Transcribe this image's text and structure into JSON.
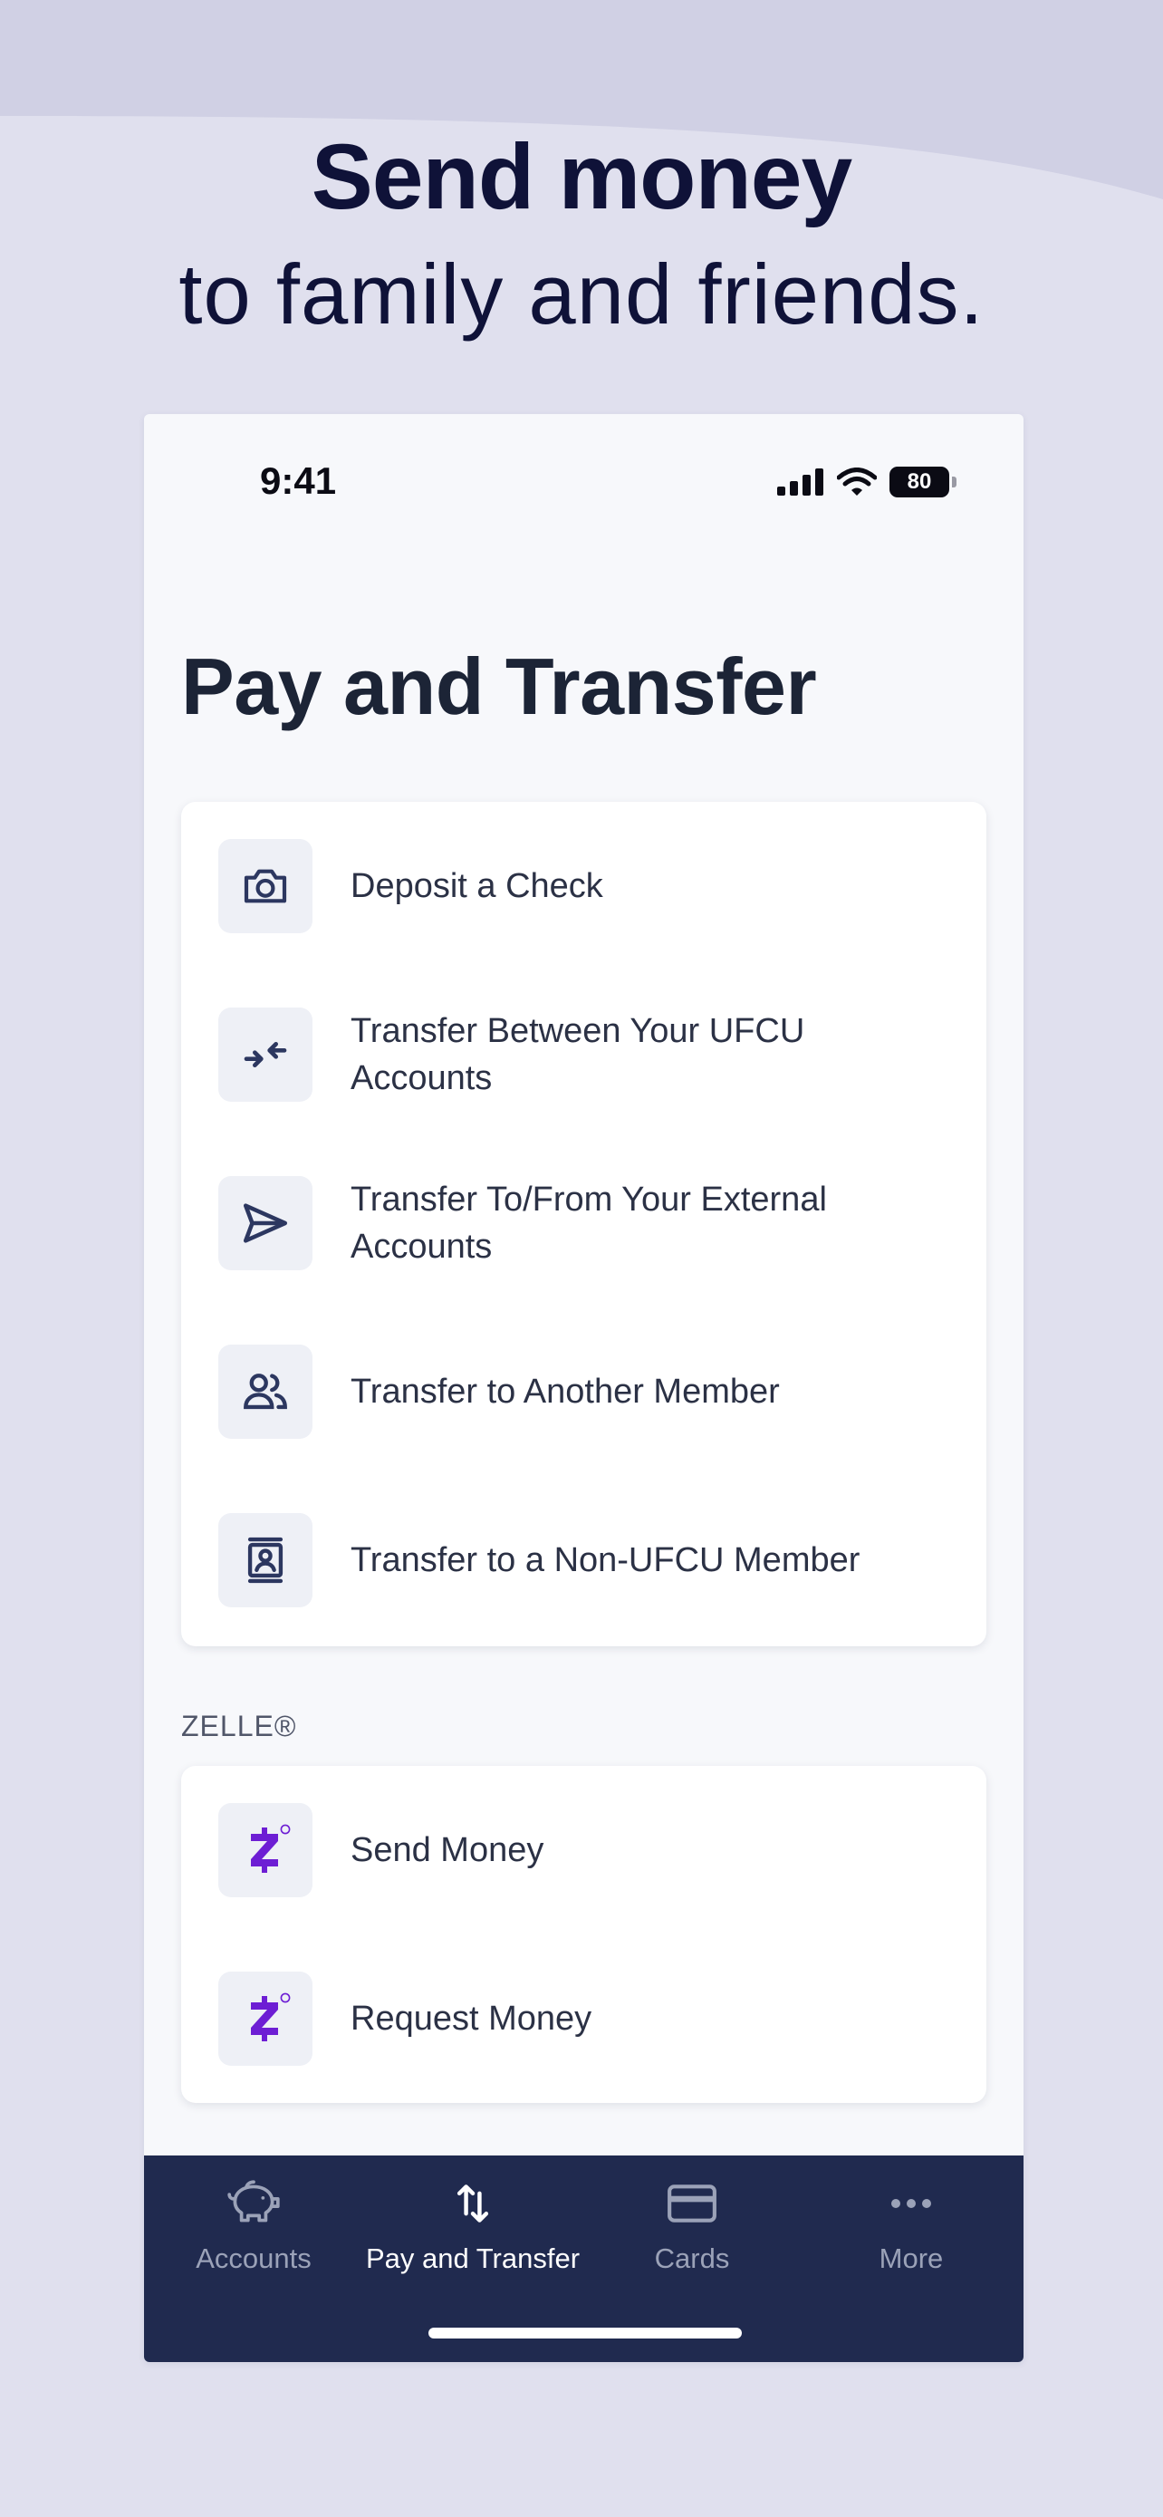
{
  "promo": {
    "title": "Send money",
    "subtitle": "to family and friends."
  },
  "status_bar": {
    "time": "9:41",
    "battery": "80",
    "icons": [
      "cellular-signal-icon",
      "wifi-icon",
      "battery-icon"
    ]
  },
  "page": {
    "title": "Pay and Transfer"
  },
  "actions": [
    {
      "label": "Deposit a Check",
      "icon": "camera-icon"
    },
    {
      "label": "Transfer Between Your UFCU Accounts",
      "icon": "arrows-transfer-icon"
    },
    {
      "label": "Transfer To/From Your External Accounts",
      "icon": "paper-plane-icon"
    },
    {
      "label": "Transfer to Another Member",
      "icon": "people-icon"
    },
    {
      "label": "Transfer to a Non-UFCU Member",
      "icon": "contact-card-icon"
    }
  ],
  "zelle": {
    "header": "ZELLE®",
    "items": [
      {
        "label": "Send Money",
        "icon": "zelle-logo-icon"
      },
      {
        "label": "Request Money",
        "icon": "zelle-logo-icon"
      }
    ]
  },
  "tabs": [
    {
      "label": "Accounts",
      "icon": "piggy-bank-icon",
      "active": false
    },
    {
      "label": "Pay and Transfer",
      "icon": "transfer-arrows-icon",
      "active": true
    },
    {
      "label": "Cards",
      "icon": "credit-card-icon",
      "active": false
    },
    {
      "label": "More",
      "icon": "more-dots-icon",
      "active": false
    }
  ],
  "colors": {
    "background": "#e0e0ee",
    "promo_text": "#0f1238",
    "tab_bar": "#202a4f",
    "icon_tint": "#2c3760",
    "zelle_purple": "#6d1ed4"
  }
}
